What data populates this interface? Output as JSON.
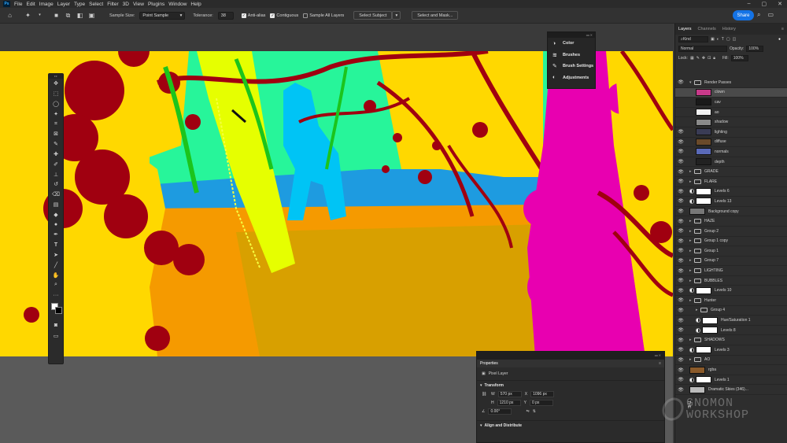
{
  "app": {
    "logo_text": "Ps"
  },
  "menu": {
    "items": [
      "File",
      "Edit",
      "Image",
      "Layer",
      "Type",
      "Select",
      "Filter",
      "3D",
      "View",
      "Plugins",
      "Window",
      "Help"
    ]
  },
  "options_bar": {
    "sample_size_label": "Sample Size:",
    "sample_size_value": "Point Sample",
    "tolerance_label": "Tolerance:",
    "tolerance_value": "38",
    "anti_alias_label": "Anti-alias",
    "contiguous_label": "Contiguous",
    "sample_all_layers_label": "Sample All Layers",
    "select_subject_label": "Select Subject",
    "select_and_mask_label": "Select and Mask...",
    "share_label": "Share"
  },
  "float_panel": {
    "items": [
      {
        "label": "Color",
        "icon": "color-icon"
      },
      {
        "label": "Brushes",
        "icon": "brushes-icon"
      },
      {
        "label": "Brush Settings",
        "icon": "brush-settings-icon"
      },
      {
        "label": "Adjustments",
        "icon": "adjustments-icon"
      }
    ]
  },
  "right_panel": {
    "tabs": [
      "Layers",
      "Channels",
      "History"
    ],
    "kind_label": "Kind",
    "blend_mode": "Normal",
    "opacity_label": "Opacity:",
    "opacity_value": "100%",
    "lock_label": "Lock:",
    "fill_label": "Fill:",
    "fill_value": "100%"
  },
  "layers": [
    {
      "name": "Render Passes",
      "type": "folder",
      "visible": true,
      "indent": 0,
      "open": true
    },
    {
      "name": "clown",
      "type": "pixel",
      "visible": false,
      "indent": 1,
      "thumb": "#c83a8a",
      "selected": true
    },
    {
      "name": "cav",
      "type": "pixel",
      "visible": false,
      "indent": 1,
      "thumb": "#1a1a1a"
    },
    {
      "name": "ao",
      "type": "pixel",
      "visible": false,
      "indent": 1,
      "thumb": "#f2f2f2"
    },
    {
      "name": "shadow",
      "type": "pixel",
      "visible": false,
      "indent": 1,
      "thumb": "#8a8a8a"
    },
    {
      "name": "lighting",
      "type": "pixel",
      "visible": true,
      "indent": 1,
      "thumb": "#3a3c55"
    },
    {
      "name": "diffuse",
      "type": "pixel",
      "visible": true,
      "indent": 1,
      "thumb": "#6a4a2a"
    },
    {
      "name": "normals",
      "type": "pixel",
      "visible": true,
      "indent": 1,
      "thumb": "#5a6ab8"
    },
    {
      "name": "depth",
      "type": "pixel",
      "visible": true,
      "indent": 1,
      "thumb": "#222222"
    },
    {
      "name": "GRADE",
      "type": "folder",
      "visible": true,
      "indent": 0
    },
    {
      "name": "FLARE",
      "type": "folder",
      "visible": true,
      "indent": 0
    },
    {
      "name": "Levels 6",
      "type": "adjust",
      "visible": true,
      "indent": 0
    },
    {
      "name": "Levels 13",
      "type": "adjust",
      "visible": true,
      "indent": 0
    },
    {
      "name": "Background copy",
      "type": "pixel",
      "visible": true,
      "indent": 0,
      "thumb": "#777777"
    },
    {
      "name": "HAZE",
      "type": "folder",
      "visible": true,
      "indent": 0
    },
    {
      "name": "Group 2",
      "type": "folder",
      "visible": true,
      "indent": 0
    },
    {
      "name": "Group 1 copy",
      "type": "folder",
      "visible": true,
      "indent": 0
    },
    {
      "name": "Group 1",
      "type": "folder",
      "visible": true,
      "indent": 0
    },
    {
      "name": "Group 7",
      "type": "folder",
      "visible": true,
      "indent": 0
    },
    {
      "name": "LIGHTING",
      "type": "folder",
      "visible": true,
      "indent": 0
    },
    {
      "name": "BUBBLES",
      "type": "folder",
      "visible": true,
      "indent": 0
    },
    {
      "name": "Levels 10",
      "type": "adjust",
      "visible": true,
      "indent": 0
    },
    {
      "name": "Hunter",
      "type": "folder",
      "visible": true,
      "indent": 0
    },
    {
      "name": "Group 4",
      "type": "folder",
      "visible": true,
      "indent": 1
    },
    {
      "name": "Hue/Saturation 1",
      "type": "adjust",
      "visible": true,
      "indent": 1
    },
    {
      "name": "Levels 8",
      "type": "adjust",
      "visible": true,
      "indent": 1
    },
    {
      "name": "SHADOWS",
      "type": "folder",
      "visible": true,
      "indent": 0
    },
    {
      "name": "Levels 3",
      "type": "adjust",
      "visible": true,
      "indent": 0
    },
    {
      "name": "AO",
      "type": "folder",
      "visible": true,
      "indent": 0
    },
    {
      "name": "rgba",
      "type": "pixel",
      "visible": true,
      "indent": 0,
      "thumb": "#8a5a2a"
    },
    {
      "name": "Levels 1",
      "type": "adjust",
      "visible": true,
      "indent": 0
    },
    {
      "name": "Dramatic Skies (346)...",
      "type": "pixel",
      "visible": true,
      "indent": 0,
      "thumb": "#bbbbbb"
    }
  ],
  "properties": {
    "title": "Properties",
    "layer_type": "Pixel Layer",
    "transform_label": "Transform",
    "w_label": "W",
    "w_value": "570 px",
    "x_label": "X",
    "x_value": "1096 px",
    "h_label": "H",
    "h_value": "1210 px",
    "y_label": "Y",
    "y_value": "0 px",
    "angle_value": "0.00°",
    "align_label": "Align and Distribute"
  },
  "watermark": {
    "the": "THE",
    "line1": "GNOMON",
    "line2": "WORKSHOP"
  },
  "colors": {
    "accent": "#1473e6",
    "canvas_yellow": "#ffd800",
    "canvas_orange": "#f59a00",
    "magenta": "#e800b0",
    "dark_red": "#a00010",
    "cyan": "#00b8f0",
    "lime": "#e6ff00",
    "mint": "#27f59a"
  }
}
